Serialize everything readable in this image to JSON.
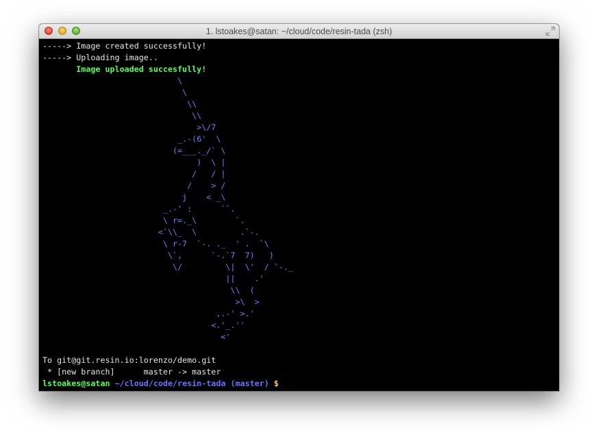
{
  "window": {
    "title": "1. lstoakes@satan: ~/cloud/code/resin-tada (zsh)",
    "buttons": [
      "close-button",
      "minimize-button",
      "zoom-button"
    ]
  },
  "terminal": {
    "lines_top": [
      "-----> Image created successfully!",
      "-----> Uploading image.."
    ],
    "upload_success": "       Image uploaded succesfully!",
    "unicorn_art": "                            \\\n                             \\\n                              \\\\\n                               \\\\\n                                >\\/7\n                            _.-(6'  \\\n                           (=___._/` \\\n                                )  \\ |\n                               /   / |\n                              /    > /\n                             j    < _\\\n                         _.-' :      ``.\n                         \\ r=._\\        `.\n                        <`\\\\_  \\         .`-.\n                         \\ r-7  `-. ._  ' .  `\\\n                          \\`,      `-.`7  7)   )\n                           \\/         \\|  \\'  / `-._\n                                      ||    .'\n                                       \\\\  (\n                                        >\\  >\n                                    ,.-' >.'\n                                   <.'_.''\n                                     <'",
    "git_lines": [
      "To git@git.resin.io:lorenzo/demo.git",
      " * [new branch]      master -> master"
    ],
    "prompt": {
      "user_host": "lstoakes@satan",
      "path": "~/cloud/code/resin-tada",
      "branch": "(master)",
      "symbol": "$"
    }
  },
  "colors": {
    "background": "#000000",
    "text": "#e6e6e6",
    "success_green": "#55ff55",
    "art_blue": "#7b7bff",
    "path_blue": "#7070ff"
  }
}
